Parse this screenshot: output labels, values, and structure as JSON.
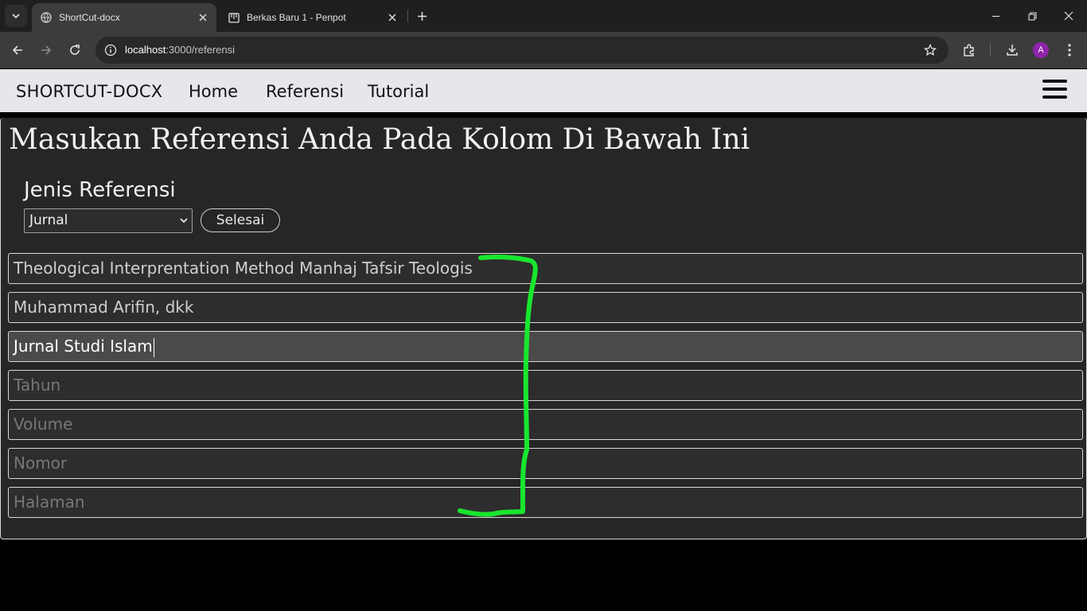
{
  "browser": {
    "tabs": [
      {
        "title": "ShortCut-docx",
        "active": true
      },
      {
        "title": "Berkas Baru 1 - Penpot",
        "active": false
      }
    ],
    "address": {
      "url_host": "localhost",
      "url_rest": ":3000/referensi"
    },
    "profile_initial": "A"
  },
  "site": {
    "brand": "SHORTCUT-DOCX",
    "nav": [
      "Home",
      "Referensi",
      "Tutorial"
    ]
  },
  "form": {
    "heading": "Masukan Referensi Anda Pada Kolom Di Bawah Ini",
    "type_label": "Jenis Referensi",
    "type_selected": "Jurnal",
    "submit_label": "Selesai",
    "fields": [
      {
        "value": "Theological Interprentation Method Manhaj Tafsir Teologis",
        "placeholder": ""
      },
      {
        "value": "Muhammad Arifin, dkk",
        "placeholder": ""
      },
      {
        "value": "Jurnal Studi Islam",
        "placeholder": ""
      },
      {
        "value": "",
        "placeholder": "Tahun"
      },
      {
        "value": "",
        "placeholder": "Volume"
      },
      {
        "value": "",
        "placeholder": "Nomor"
      },
      {
        "value": "",
        "placeholder": "Halaman"
      }
    ]
  },
  "colors": {
    "annotation": "#19e62e",
    "nav_bg": "#e5e7eb",
    "card_bg": "#262626"
  }
}
